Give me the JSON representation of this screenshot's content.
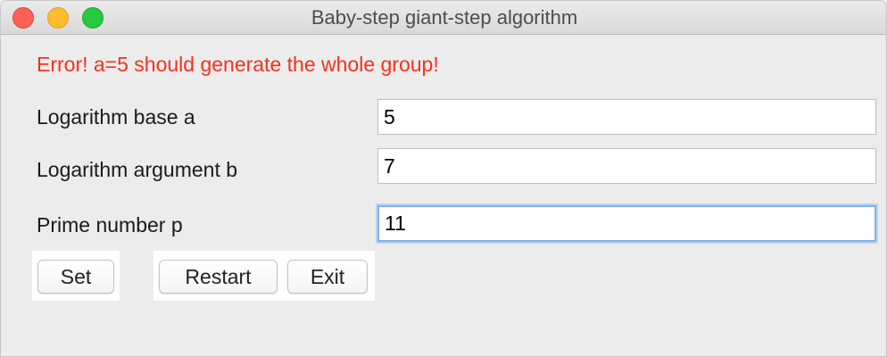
{
  "window": {
    "title": "Baby-step giant-step algorithm"
  },
  "error": {
    "message": "Error! a=5 should generate the whole group!",
    "color": "#f5321e"
  },
  "form": {
    "base_label": "Logarithm base a",
    "base_value": "5",
    "argument_label": "Logarithm argument b",
    "argument_value": "7",
    "prime_label": "Prime number p",
    "prime_value": "11"
  },
  "buttons": {
    "set_label": "Set",
    "restart_label": "Restart",
    "exit_label": "Exit"
  },
  "focused_field": "prime_value",
  "focus_color": "#7fb1ee"
}
